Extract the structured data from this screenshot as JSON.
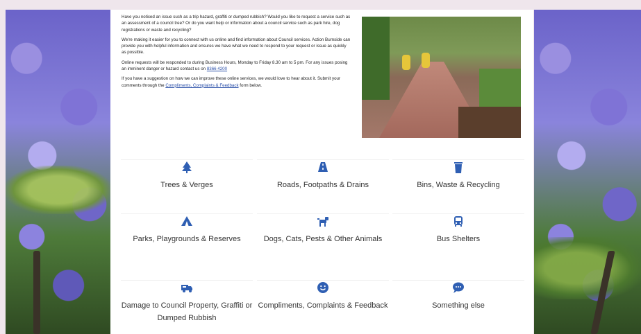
{
  "intro": {
    "p1": "Have you noticed an issue such as a trip hazard, graffiti or dumped rubbish? Would you like to request a service such as an assessment of a council tree? Or do you want help or information about a council service such as park hire, dog registrations or waste and recycling?",
    "p2": "We're making it easier for you to connect with us online and find information about Council services. Action Burnside can provide you with helpful information and ensures we have what we need to respond to your request or issue as quickly as possible.",
    "p3_text": "Online requests will be responded to during Business Hours, Monday to Friday 8.30 am to 5 pm. For any issues posing an imminent danger or hazard contact us on",
    "p3_link": "8366 4200",
    "p4_text": "If you have a suggestion on how we can improve these online services, we would love to hear about it. Submit your comments through the",
    "p4_link": "Compliments, Complaints & Feedback",
    "p4_end": "form below."
  },
  "tiles": [
    {
      "label": "Trees & Verges",
      "icon": "tree-icon"
    },
    {
      "label": "Roads, Footpaths & Drains",
      "icon": "road-icon"
    },
    {
      "label": "Bins, Waste & Recycling",
      "icon": "bin-icon"
    },
    {
      "label": "Parks, Playgrounds & Reserves",
      "icon": "tent-icon"
    },
    {
      "label": "Dogs, Cats, Pests & Other Animals",
      "icon": "dog-icon"
    },
    {
      "label": "Bus Shelters",
      "icon": "bus-icon"
    },
    {
      "label": "Damage to Council Property, Graffiti or Dumped Rubbish",
      "icon": "truck-icon"
    },
    {
      "label": "Compliments, Complaints & Feedback",
      "icon": "smiley-icon"
    },
    {
      "label": "Something else",
      "icon": "chat-icon"
    }
  ],
  "colors": {
    "accent": "#2f5fb3",
    "page_bg": "#efe6ec"
  }
}
